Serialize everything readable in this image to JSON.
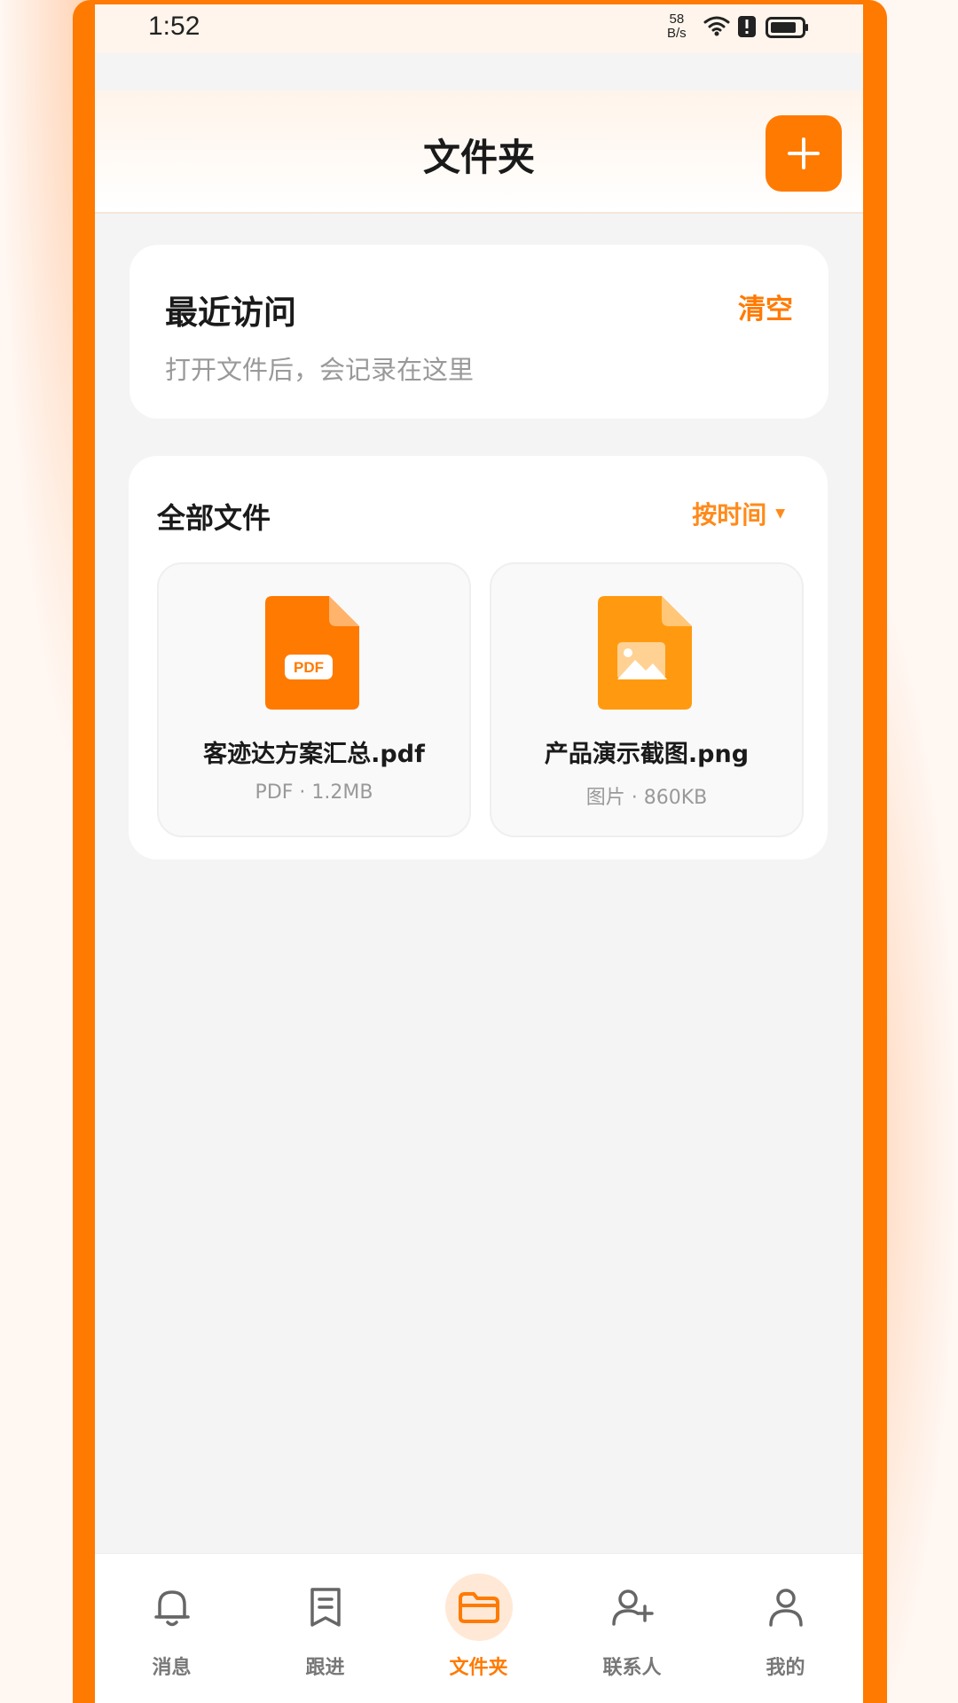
{
  "status_bar": {
    "time": "1:52",
    "net_speed_value": "58",
    "net_speed_unit": "B/s"
  },
  "header": {
    "title": "文件夹",
    "add_icon": "plus-icon"
  },
  "recent": {
    "title": "最近访问",
    "clear_label": "清空",
    "empty_hint": "打开文件后，会记录在这里"
  },
  "files": {
    "title": "全部文件",
    "sort_label": "按时间",
    "sort_icon": "triangle-down-icon",
    "items": [
      {
        "name": "客迹达方案汇总.pdf",
        "meta": "PDF · 1.2MB",
        "icon": "pdf-file-icon",
        "icon_label": "PDF",
        "color": "#ff7a00"
      },
      {
        "name": "产品演示截图.png",
        "meta": "图片 · 860KB",
        "icon": "image-file-icon",
        "color": "#ff9a10"
      }
    ]
  },
  "tabbar": {
    "tabs": [
      {
        "label": "消息",
        "icon": "bell-icon",
        "active": false
      },
      {
        "label": "跟进",
        "icon": "note-icon",
        "active": false
      },
      {
        "label": "文件夹",
        "icon": "folder-icon",
        "active": true
      },
      {
        "label": "联系人",
        "icon": "add-user-icon",
        "active": false
      },
      {
        "label": "我的",
        "icon": "user-icon",
        "active": false
      }
    ]
  },
  "colors": {
    "accent": "#ff7a00",
    "background": "#f4f4f4"
  }
}
